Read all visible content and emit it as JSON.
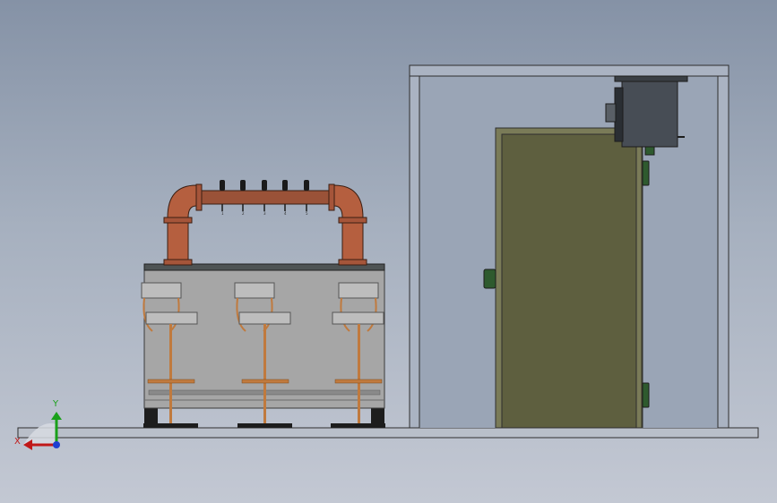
{
  "viewport": {
    "colors": {
      "background_top": "#8592a6",
      "background_bottom": "#c3c8d3",
      "floor": "#b9bfc9",
      "room_wall": "#9aa5b6",
      "door_panel": "#5e5f3f",
      "door_handle": "#2e5a2e",
      "copper_pipe": "#b55f3f",
      "counter_steel": "#a6a6a6",
      "countertop": "#4e5354",
      "stool_frame": "#c07a3e",
      "unit_body": "#474d55"
    },
    "icons": {
      "coordinate_triad": "xyz-triad-icon"
    }
  },
  "bar_counter": {
    "tap_numbers": [
      "1",
      "2",
      "3",
      "4",
      "5"
    ],
    "stool_count": 3
  },
  "triad": {
    "y_label": "Y",
    "x_label": "X"
  }
}
